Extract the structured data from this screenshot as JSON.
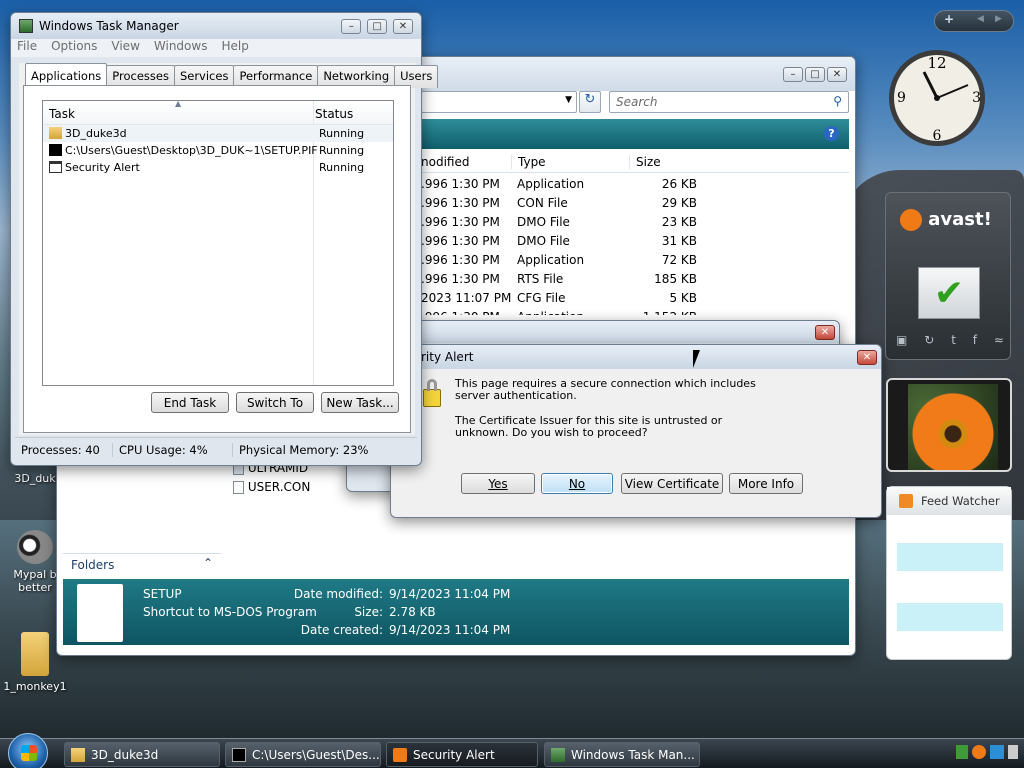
{
  "task_manager": {
    "title": "Windows Task Manager",
    "menu": [
      "File",
      "Options",
      "View",
      "Windows",
      "Help"
    ],
    "tabs": [
      "Applications",
      "Processes",
      "Services",
      "Performance",
      "Networking",
      "Users"
    ],
    "columns": {
      "task": "Task",
      "status": "Status"
    },
    "rows": [
      {
        "task": "3D_duke3d",
        "status": "Running"
      },
      {
        "task": "C:\\Users\\Guest\\Desktop\\3D_DUK~1\\SETUP.PIF",
        "status": "Running"
      },
      {
        "task": "Security Alert",
        "status": "Running"
      }
    ],
    "buttons": {
      "end_task": "End Task",
      "switch_to": "Switch To",
      "new_task": "New Task..."
    },
    "status": {
      "processes": "Processes: 40",
      "cpu": "CPU Usage: 4%",
      "memory": "Physical Memory: 23%"
    }
  },
  "explorer": {
    "search_placeholder": "Search",
    "columns": {
      "modified": "nodified",
      "type": "Type",
      "size": "Size"
    },
    "files": [
      {
        "modified": ".996 1:30 PM",
        "type": "Application",
        "size": "26 KB"
      },
      {
        "modified": ".996 1:30 PM",
        "type": "CON File",
        "size": "29 KB"
      },
      {
        "modified": ".996 1:30 PM",
        "type": "DMO File",
        "size": "23 KB"
      },
      {
        "modified": ".996 1:30 PM",
        "type": "DMO File",
        "size": "31 KB"
      },
      {
        "modified": ".996 1:30 PM",
        "type": "Application",
        "size": "72 KB"
      },
      {
        "modified": ".996 1:30 PM",
        "type": "RTS File",
        "size": "185 KB"
      },
      {
        "modified": "2023 11:07 PM",
        "type": "CFG File",
        "size": "5 KB"
      },
      {
        "modified": ".996 1:30 PM",
        "type": "Application",
        "size": "1,152 KB"
      }
    ],
    "lower_files": [
      "ULTRAMID",
      "USER.CON"
    ],
    "folders_label": "Folders",
    "details": {
      "name": "SETUP",
      "kind": "Shortcut to MS-DOS Program",
      "modified_label": "Date modified:",
      "modified": "9/14/2023 11:04 PM",
      "size_label": "Size:",
      "size": "2.78 KB",
      "created_label": "Date created:",
      "created": "9/14/2023 11:04 PM"
    }
  },
  "security_alert": {
    "title": "rity Alert",
    "line1": "This page requires a secure connection which includes",
    "line2": "server authentication.",
    "line3": "The Certificate Issuer for this site is untrusted or",
    "line4": "unknown.  Do you wish to proceed?",
    "buttons": {
      "yes": "Yes",
      "no": "No",
      "view_cert": "View Certificate",
      "more_info": "More Info"
    }
  },
  "gadgets": {
    "avast": "avast!",
    "feed_watcher": "Feed Watcher"
  },
  "desktop_icons": [
    {
      "label": "3D_duk"
    },
    {
      "label": "Mypal b better"
    },
    {
      "label": "1_monkey1"
    }
  ],
  "taskbar": {
    "items": [
      "3D_duke3d",
      "C:\\Users\\Guest\\Des...",
      "Security Alert",
      "Windows Task Man..."
    ]
  },
  "colors": {
    "accent_teal": "#1b7a87",
    "selection_blue": "#cfe3f6"
  }
}
